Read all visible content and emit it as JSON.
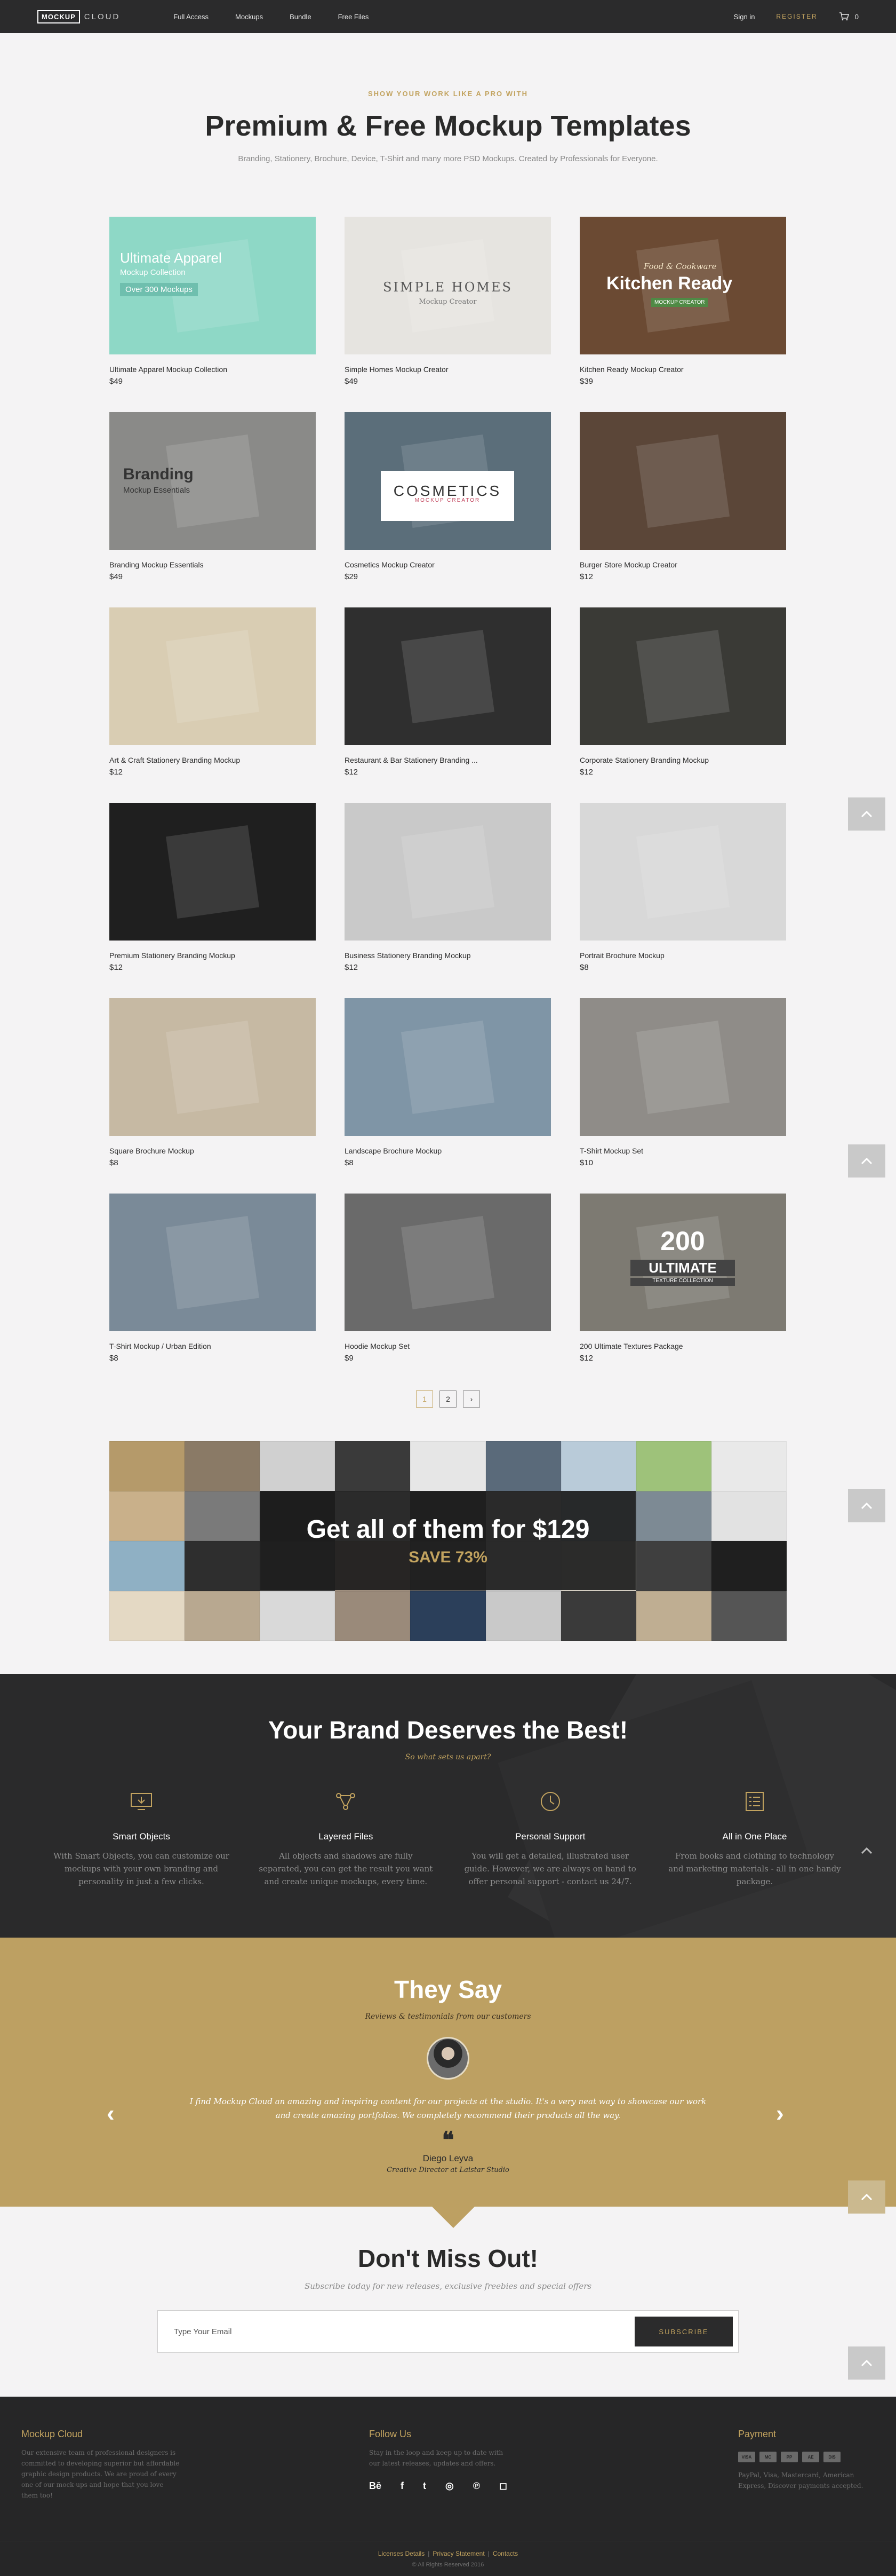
{
  "nav": {
    "logo_box": "MOCKUP",
    "logo_text": "CLOUD",
    "links": [
      "Full Access",
      "Mockups",
      "Bundle",
      "Free Files"
    ],
    "sign_in": "Sign in",
    "register": "REGISTER",
    "cart_icon": "cart-icon",
    "cart_count": "0"
  },
  "hero": {
    "eyebrow": "SHOW YOUR WORK LIKE A PRO WITH",
    "title": "Premium & Free Mockup Templates",
    "subtitle": "Branding, Stationery, Brochure, Device, T-Shirt and many more PSD Mockups. Created by Professionals for Everyone."
  },
  "products": [
    {
      "title": "Ultimate Apparel Mockup Collection",
      "price": "$49",
      "color": "#8ed8c6",
      "overlay": {
        "l1": "Ultimate Apparel",
        "l2": "Mockup Collection",
        "l3": "Over 300 Mockups"
      }
    },
    {
      "title": "Simple Homes Mockup Creator",
      "price": "$49",
      "color": "#e6e4e0",
      "overlay": {
        "l1": "SIMPLE HOMES",
        "l2": "Mockup Creator"
      }
    },
    {
      "title": "Kitchen Ready Mockup Creator",
      "price": "$39",
      "color": "#6b4a33",
      "overlay": {
        "l0": "Food & Cookware",
        "l1": "Kitchen Ready",
        "l2": "MOCKUP CREATOR"
      }
    },
    {
      "title": "Branding Mockup Essentials",
      "price": "$49",
      "color": "#8a8a88",
      "overlay": {
        "l1": "Branding",
        "l2": "Mockup Essentials"
      }
    },
    {
      "title": "Cosmetics Mockup Creator",
      "price": "$29",
      "color": "#5b6e7a",
      "overlay": {
        "l1": "COSMETICS",
        "l2": "MOCKUP CREATOR"
      }
    },
    {
      "title": "Burger Store Mockup Creator",
      "price": "$12",
      "color": "#5b4638"
    },
    {
      "title": "Art & Craft Stationery Branding Mockup",
      "price": "$12",
      "color": "#d9cdb3"
    },
    {
      "title": "Restaurant & Bar Stationery Branding ...",
      "price": "$12",
      "color": "#2f2f2f"
    },
    {
      "title": "Corporate Stationery Branding Mockup",
      "price": "$12",
      "color": "#3a3a36"
    },
    {
      "title": "Premium Stationery Branding Mockup",
      "price": "$12",
      "color": "#1f1f1f"
    },
    {
      "title": "Business Stationery Branding Mockup",
      "price": "$12",
      "color": "#c9c9c9"
    },
    {
      "title": "Portrait Brochure Mockup",
      "price": "$8",
      "color": "#d8d8d8"
    },
    {
      "title": "Square Brochure Mockup",
      "price": "$8",
      "color": "#c6b9a3"
    },
    {
      "title": "Landscape Brochure Mockup",
      "price": "$8",
      "color": "#7f95a6"
    },
    {
      "title": "T-Shirt Mockup Set",
      "price": "$10",
      "color": "#8f8c88"
    },
    {
      "title": "T-Shirt Mockup / Urban Edition",
      "price": "$8",
      "color": "#7a8a98"
    },
    {
      "title": "Hoodie Mockup Set",
      "price": "$9",
      "color": "#6a6a6a"
    },
    {
      "title": "200 Ultimate Textures Package",
      "price": "$12",
      "color": "#7d7a72",
      "overlay": {
        "l1": "200",
        "l2": "ULTIMATE",
        "l3": "TEXTURE COLLECTION"
      }
    }
  ],
  "pagination": {
    "pages": [
      "1",
      "2"
    ],
    "next": "›"
  },
  "bundle": {
    "headline": "Get all of them for $129",
    "save": "SAVE 73%",
    "tiles": [
      "#b59a6a",
      "#8a7a66",
      "#d0d0d0",
      "#3a3a3a",
      "#e6e6e6",
      "#5a6a7a",
      "#b9cbd9",
      "#9ec27a",
      "#e9e9e9",
      "#c9b08a",
      "#7a7a7a",
      "#2b2b2b",
      "#d4d4d4",
      "#444444",
      "#cfcfcf",
      "#a7b7c7",
      "#7d8a94",
      "#e2e2e2",
      "#8fb0c4",
      "#2e2e2e",
      "#3f3f3f",
      "#a09080",
      "#5a5a5a",
      "#c4c4c4",
      "#d6d0c4",
      "#3f3f3f",
      "#1f1f1f",
      "#e4d9c4",
      "#b8a890",
      "#d9d9d9",
      "#9a8a7a",
      "#2b3f5a",
      "#c9c9c9",
      "#3a3a3a",
      "#bfae92",
      "#555555"
    ]
  },
  "features": {
    "title": "Your Brand Deserves the Best!",
    "subtitle": "So what sets us apart?",
    "items": [
      {
        "icon": "monitor-icon",
        "title": "Smart Objects",
        "text": "With Smart Objects, you can customize our mockups with your own branding and personality in just a few clicks."
      },
      {
        "icon": "layers-node-icon",
        "title": "Layered Files",
        "text": "All objects and shadows are fully separated, you can get the result you want and create unique mockups, every time."
      },
      {
        "icon": "clock-icon",
        "title": "Personal Support",
        "text": "You will get a detailed, illustrated user guide. However, we are always on hand to offer personal support - contact us 24/7."
      },
      {
        "icon": "list-icon",
        "title": "All in One Place",
        "text": "From books and clothing to technology and marketing materials - all in one handy package."
      }
    ]
  },
  "testimonials": {
    "title": "They Say",
    "subtitle": "Reviews & testimonials from our customers",
    "quote": "I find Mockup Cloud an amazing and inspiring content for our projects at the studio. It's a very neat way to showcase our work and create amazing portfolios. We completely recommend their products all the way.",
    "quote_mark": "❝",
    "name": "Diego Leyva",
    "role": "Creative Director at Laistar Studio",
    "prev": "‹",
    "next": "›"
  },
  "newsletter": {
    "title": "Don't Miss Out!",
    "subtitle": "Subscribe today for new releases, exclusive freebies and special offers",
    "placeholder": "Type Your Email",
    "button": "SUBSCRIBE"
  },
  "footer": {
    "about_title": "Mockup Cloud",
    "about_text": "Our extensive team of professional designers is committed to developing superior but affordable graphic design products. We are proud of every one of our mock-ups and hope that you love them too!",
    "follow_title": "Follow Us",
    "follow_text": "Stay in the loop and keep up to date with our latest releases, updates and offers.",
    "social": [
      "Bē",
      "f",
      "t",
      "◎",
      "℗",
      "◻"
    ],
    "payment_title": "Payment",
    "payment_cards": [
      "VISA",
      "MC",
      "PP",
      "AE",
      "DIS"
    ],
    "payment_text": "PayPal, Visa, Mastercard, American Express, Discover payments accepted.",
    "links": [
      "Licenses Details",
      "Privacy Statement",
      "Contacts"
    ],
    "copyright": "© All Rights Reserved 2016"
  },
  "back_to_top_icon": "chevron-up-icon"
}
